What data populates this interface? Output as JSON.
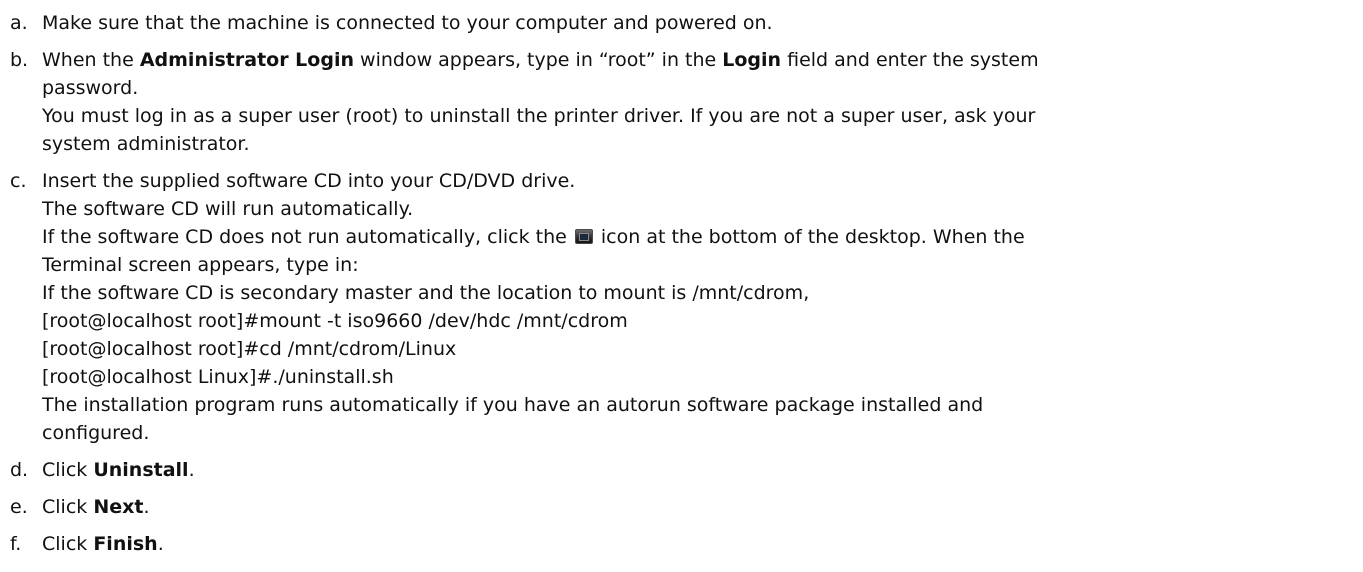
{
  "steps": [
    {
      "marker": "a.",
      "text": "Make sure that the machine is connected to your computer and powered on."
    },
    {
      "marker": "b.",
      "line1_pre": "When the ",
      "line1_bold1": "Administrator Login",
      "line1_mid": " window appears, type in “root” in the ",
      "line1_bold2": "Login",
      "line1_post": " field and enter the system",
      "line2": "password.",
      "line3": "You must log in as a super user (root) to uninstall the printer driver. If you are not a super user, ask your",
      "line4": "system administrator."
    },
    {
      "marker": "c.",
      "line1": "Insert the supplied software CD into your CD/DVD drive.",
      "line2": "The software CD will run automatically.",
      "line3_pre": "If the software CD does not run automatically, click the ",
      "line3_post": " icon at the bottom of the desktop. When the",
      "line4": "Terminal screen appears, type in:",
      "line5": "If the software CD is secondary master and the location to mount is /mnt/cdrom,",
      "cmd1": "[root@localhost root]#mount -t iso9660 /dev/hdc /mnt/cdrom",
      "cmd2": "[root@localhost root]#cd /mnt/cdrom/Linux",
      "cmd3": "[root@localhost Linux]#./uninstall.sh",
      "line6": "The installation program runs automatically if you have an autorun software package installed and",
      "line7": "configured."
    },
    {
      "marker": "d.",
      "pre": "Click ",
      "bold": "Uninstall",
      "post": "."
    },
    {
      "marker": "e.",
      "pre": "Click ",
      "bold": "Next",
      "post": "."
    },
    {
      "marker": "f.",
      "pre": "Click ",
      "bold": "Finish",
      "post": "."
    }
  ],
  "icons": {
    "terminal": "terminal-icon"
  }
}
